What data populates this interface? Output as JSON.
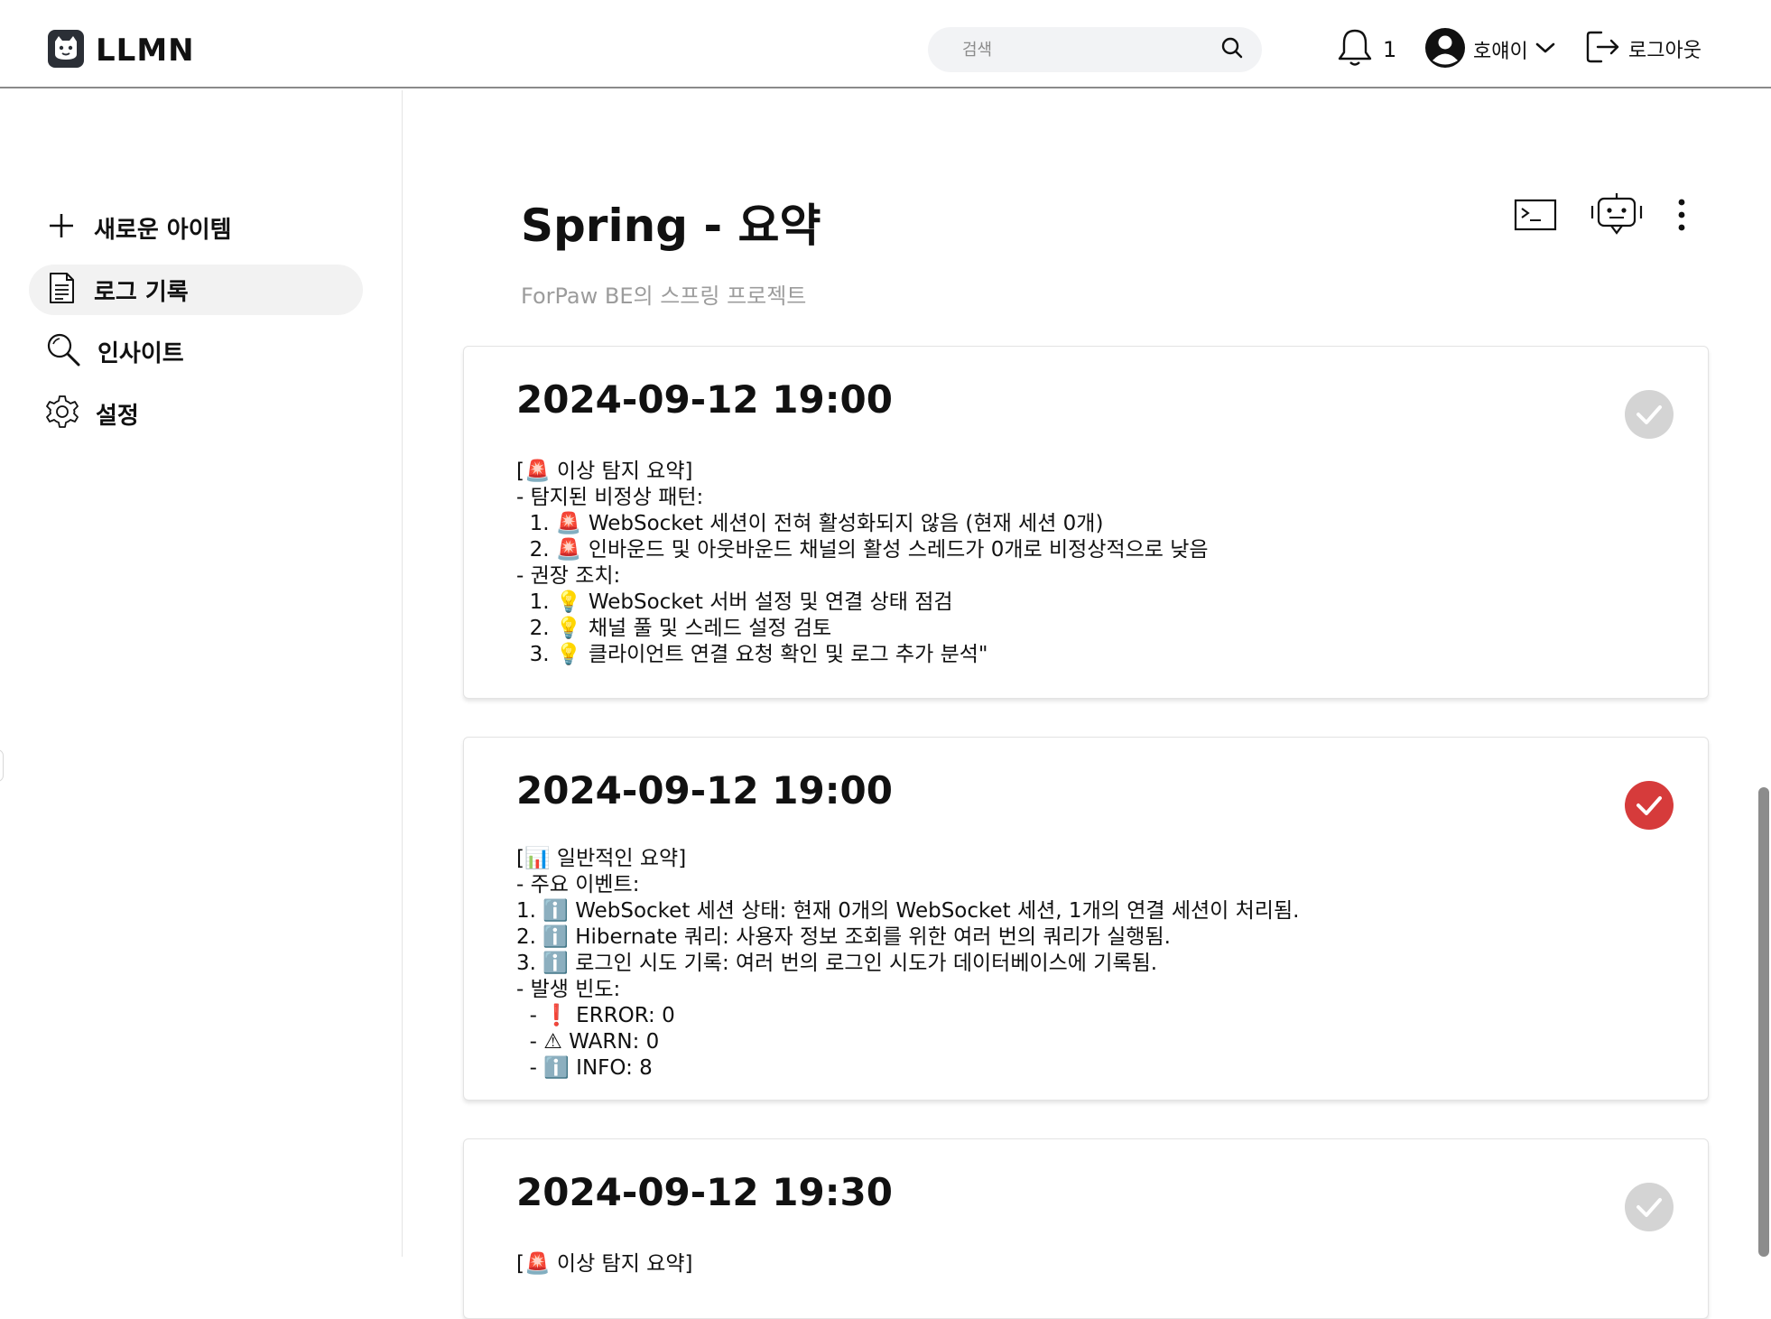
{
  "app": {
    "title": "LLMN"
  },
  "header": {
    "search_placeholder": "검색",
    "notification_count": "1",
    "user_name": "호얘이",
    "logout_label": "로그아웃"
  },
  "sidebar": {
    "items": [
      {
        "label": "새로운 아이템",
        "icon": "plus-icon"
      },
      {
        "label": "로그 기록",
        "icon": "document-icon",
        "active": true
      },
      {
        "label": "인사이트",
        "icon": "search-icon"
      },
      {
        "label": "설정",
        "icon": "gear-icon"
      }
    ]
  },
  "main": {
    "title": "Spring - 요약",
    "description": "ForPaw BE의 스프링 프로젝트",
    "tools": [
      "terminal-icon",
      "robot-icon",
      "more-vertical-icon"
    ]
  },
  "cards": [
    {
      "date": "2024-09-12 19:00",
      "status": "unchecked",
      "body": "[🚨 이상 탐지 요약]\n- 탐지된 비정상 패턴:\n  1. 🚨 WebSocket 세션이 전혀 활성화되지 않음 (현재 세션 0개)\n  2. 🚨 인바운드 및 아웃바운드 채널의 활성 스레드가 0개로 비정상적으로 낮음\n- 권장 조치:\n  1. 💡 WebSocket 서버 설정 및 연결 상태 점검\n  2. 💡 채널 풀 및 스레드 설정 검토\n  3. 💡 클라이언트 연결 요청 확인 및 로그 추가 분석\""
    },
    {
      "date": "2024-09-12 19:00",
      "status": "checked",
      "body": "[📊 일반적인 요약]\n- 주요 이벤트:\n1. ℹ️ WebSocket 세션 상태: 현재 0개의 WebSocket 세션, 1개의 연결 세션이 처리됨.\n2. ℹ️ Hibernate 쿼리: 사용자 정보 조회를 위한 여러 번의 쿼리가 실행됨.\n3. ℹ️ 로그인 시도 기록: 여러 번의 로그인 시도가 데이터베이스에 기록됨.\n- 발생 빈도:\n  - ❗ ERROR: 0\n  - ⚠ WARN: 0\n  - ℹ️ INFO: 8"
    },
    {
      "date": "2024-09-12 19:30",
      "status": "unchecked",
      "body": "[🚨 이상 탐지 요약]"
    }
  ],
  "colors": {
    "checked": "#d63b3b",
    "unchecked": "#d4d4d4",
    "accent": "#111111"
  }
}
